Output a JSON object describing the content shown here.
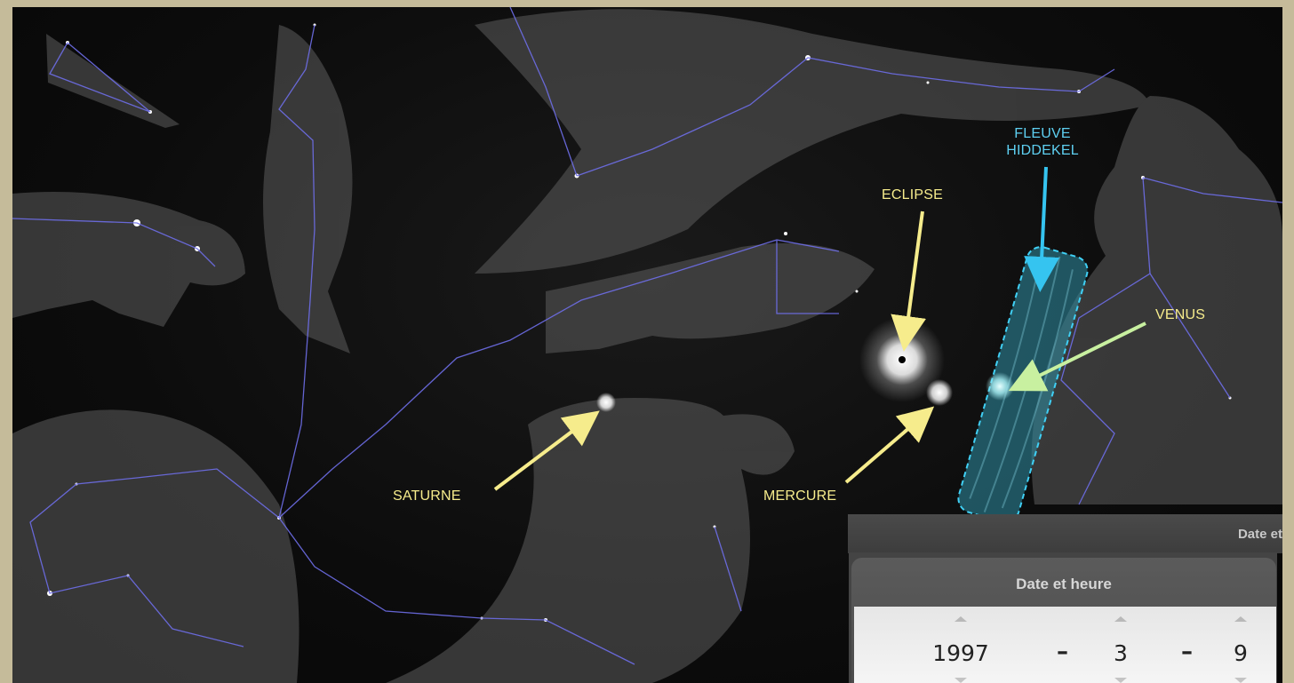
{
  "annotations": {
    "eclipse": "ECLIPSE",
    "fleuve_line1": "FLEUVE",
    "fleuve_line2": "HIDDEKEL",
    "venus": "VENUS",
    "saturne": "SATURNE",
    "mercure": "MERCURE"
  },
  "date_panel": {
    "strip_title": "Date et",
    "title": "Date et heure",
    "year": "1997",
    "separator": "–",
    "month": "3",
    "day": "9"
  },
  "colors": {
    "label_yellow": "#f6ec8c",
    "label_blue": "#5ed0f2",
    "constellation_lines": "#6e6ee8"
  }
}
